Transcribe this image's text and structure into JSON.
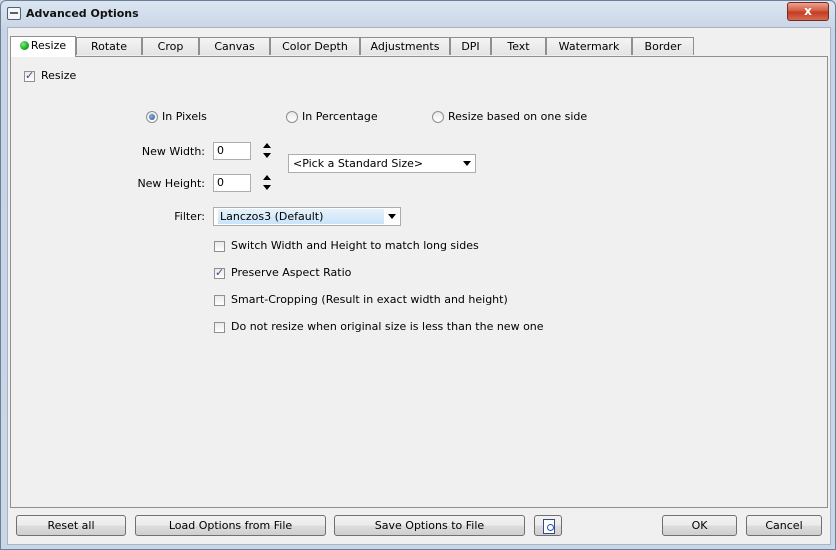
{
  "window": {
    "title": "Advanced Options",
    "close_label": "x"
  },
  "tabs": [
    {
      "label": "Resize",
      "active": true
    },
    {
      "label": "Rotate"
    },
    {
      "label": "Crop"
    },
    {
      "label": "Canvas"
    },
    {
      "label": "Color Depth"
    },
    {
      "label": "Adjustments"
    },
    {
      "label": "DPI"
    },
    {
      "label": "Text"
    },
    {
      "label": "Watermark"
    },
    {
      "label": "Border"
    }
  ],
  "resize": {
    "enable_label": "Resize",
    "enable_checked": true,
    "mode": {
      "pixels_label": "In Pixels",
      "percentage_label": "In Percentage",
      "one_side_label": "Resize based on one side",
      "selected": "pixels"
    },
    "width_label": "New Width:",
    "width_value": "0",
    "height_label": "New Height:",
    "height_value": "0",
    "standard_size": "<Pick a Standard Size>",
    "filter_label": "Filter:",
    "filter_value": "Lanczos3 (Default)",
    "options": [
      {
        "label": "Switch Width and Height to match long sides",
        "checked": false
      },
      {
        "label": "Preserve Aspect Ratio",
        "checked": true
      },
      {
        "label": "Smart-Cropping (Result in exact width and height)",
        "checked": false
      },
      {
        "label": "Do not resize when original size is less than the new one",
        "checked": false
      }
    ]
  },
  "footer": {
    "reset_all": "Reset all",
    "load_options": "Load Options from File",
    "save_options": "Save Options to File",
    "ok": "OK",
    "cancel": "Cancel"
  }
}
